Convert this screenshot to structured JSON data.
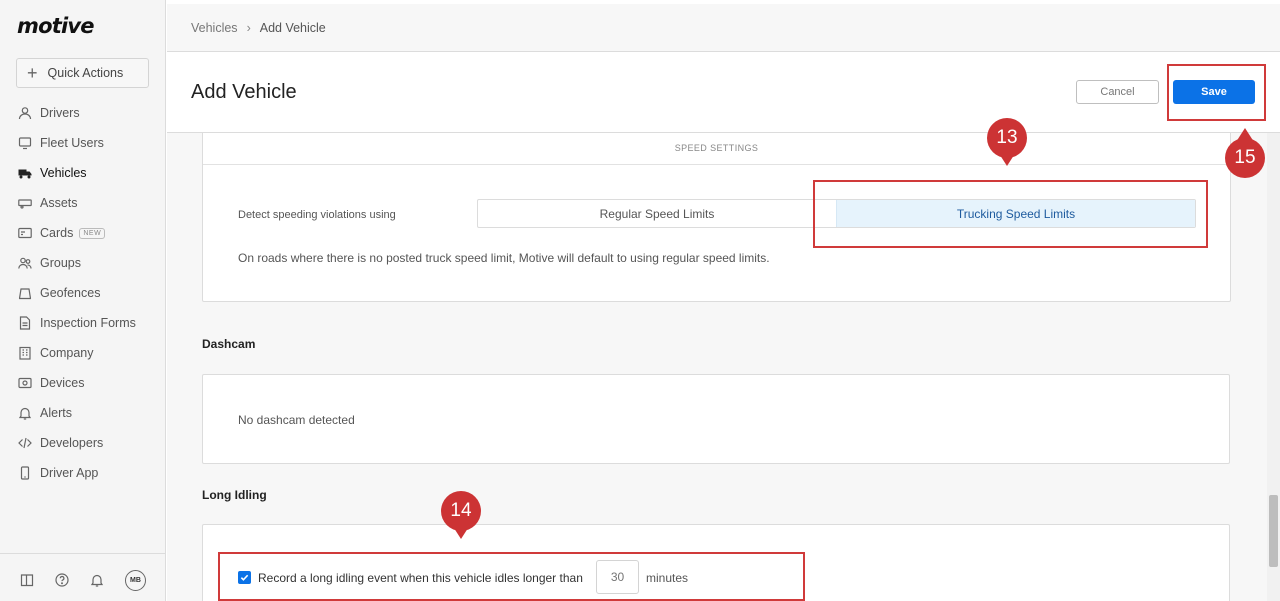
{
  "app": {
    "logo": "motive"
  },
  "sidebar": {
    "quick_actions": "Quick Actions",
    "items": [
      {
        "label": "Drivers",
        "icon": "person-icon"
      },
      {
        "label": "Fleet Users",
        "icon": "monitor-icon"
      },
      {
        "label": "Vehicles",
        "icon": "truck-icon",
        "active": true
      },
      {
        "label": "Assets",
        "icon": "trailer-icon"
      },
      {
        "label": "Cards",
        "icon": "card-icon",
        "badge": "NEW"
      },
      {
        "label": "Groups",
        "icon": "groups-icon"
      },
      {
        "label": "Geofences",
        "icon": "geofence-icon"
      },
      {
        "label": "Inspection Forms",
        "icon": "form-icon"
      },
      {
        "label": "Company",
        "icon": "building-icon"
      },
      {
        "label": "Devices",
        "icon": "devices-icon"
      },
      {
        "label": "Alerts",
        "icon": "bell-icon"
      },
      {
        "label": "Developers",
        "icon": "code-icon"
      },
      {
        "label": "Driver App",
        "icon": "phone-icon"
      }
    ],
    "bottom": {
      "avatar": "MB"
    }
  },
  "breadcrumb": {
    "parent": "Vehicles",
    "separator": "›",
    "current": "Add Vehicle"
  },
  "header": {
    "title": "Add Vehicle",
    "cancel": "Cancel",
    "save": "Save"
  },
  "speed_settings": {
    "heading": "SPEED SETTINGS",
    "detect_label": "Detect speeding violations using",
    "options": [
      "Regular Speed Limits",
      "Trucking Speed Limits"
    ],
    "selected": "Trucking Speed Limits",
    "note": "On roads where there is no posted truck speed limit, Motive will default to using regular speed limits."
  },
  "dashcam": {
    "title": "Dashcam",
    "message": "No dashcam detected"
  },
  "long_idling": {
    "title": "Long Idling",
    "checkbox_label": "Record a long idling event when this vehicle idles longer than",
    "checked": true,
    "placeholder": "30",
    "unit": "minutes"
  },
  "annotations": {
    "step_13": "13",
    "step_14": "14",
    "step_15": "15",
    "color": "#cc3334"
  },
  "colors": {
    "primary": "#0b72e7",
    "selected_bg": "#e6f3fc",
    "selected_text": "#1d5a9e"
  }
}
